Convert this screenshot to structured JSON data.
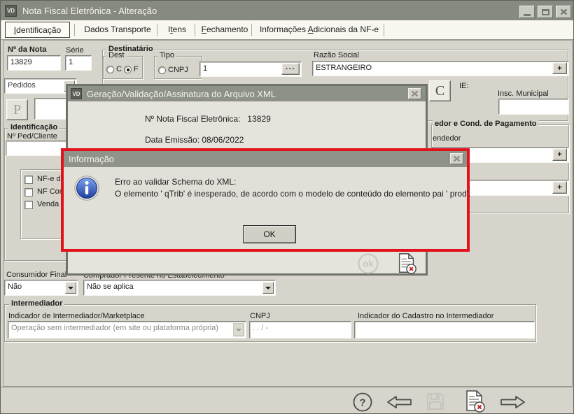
{
  "colors": {
    "accent_red": "#e2121c",
    "titlebar_gray": "#868a80",
    "info_blue": "#2b56c0"
  },
  "window": {
    "title": "Nota Fiscal Eletrônica - Alteração",
    "icon_text": "VD"
  },
  "tabs": [
    {
      "pre": "",
      "accel": "I",
      "post": "dentificação"
    },
    {
      "pre": "Dados Transporte",
      "accel": "",
      "post": ""
    },
    {
      "pre": "I",
      "accel": "t",
      "post": "ens"
    },
    {
      "pre": "",
      "accel": "F",
      "post": "echamento"
    },
    {
      "pre": "Informações ",
      "accel": "A",
      "post": "dicionais da NF-e"
    }
  ],
  "form": {
    "nota": {
      "label": "Nº da Nota",
      "value": "13829"
    },
    "serie": {
      "label": "Série",
      "value": "1"
    },
    "destinatario": {
      "group_label": "Destinatário",
      "dest_label": "Dest",
      "radio_c": "C",
      "radio_f": "F",
      "tipo_label": "Tipo",
      "radio_cnpj": "CNPJ",
      "codigo_value": "1",
      "browse_button": "···",
      "razao_label": "Razão Social",
      "razao_value": "ESTRANGEIRO",
      "add_button": "+",
      "consulta_button": "C",
      "ie_label": "IE:",
      "insc_municipal_label": "Insc. Municipal"
    },
    "pedidos_value": "Pedidos",
    "p_button": "P",
    "identificacao": {
      "group_label": "Identificação",
      "ped_cliente_label": "Nº Ped/Cliente",
      "checkboxes": [
        "NF-e de A",
        "NF Comp",
        "Venda pa"
      ]
    },
    "vendedor": {
      "group_label_fragment": "edor e Cond. de Pagamento",
      "vendedor_label_fragment": "endedor",
      "add_button": "+"
    },
    "consumidor_final": {
      "label": "Consumidor Final",
      "value": "Não"
    },
    "comprador": {
      "label": "Comprador Presente no Estabelecimento",
      "value": "Não se aplica"
    },
    "intermediador": {
      "group_label": "Intermediador",
      "indicador_label": "Indicador de Intermediador/Marketplace",
      "indicador_value": "Operação sem intermediador (em site ou plataforma própria)",
      "cnpj_label": "CNPJ",
      "cnpj_mask": " .    .    /    -",
      "cadastro_label": "Indicador do Cadastro no Intermediador"
    }
  },
  "xml_dialog": {
    "title": "Geração/Validação/Assinatura do Arquivo XML",
    "icon_text": "VD",
    "nota_line": "Nº Nota Fiscal Eletrônica:   13829",
    "emissao_line": "Data Emissão: 08/06/2022",
    "ok_icon_text": "ok"
  },
  "info_dialog": {
    "title": "Informação",
    "message_line1": "Erro ao validar Schema do XML:",
    "message_line2": "O elemento ' qTrib' é inesperado, de acordo com o modelo de conteúdo do elemento pai ' prod'.",
    "ok_button": "OK"
  },
  "toolbar": {
    "help_glyph": "?"
  }
}
